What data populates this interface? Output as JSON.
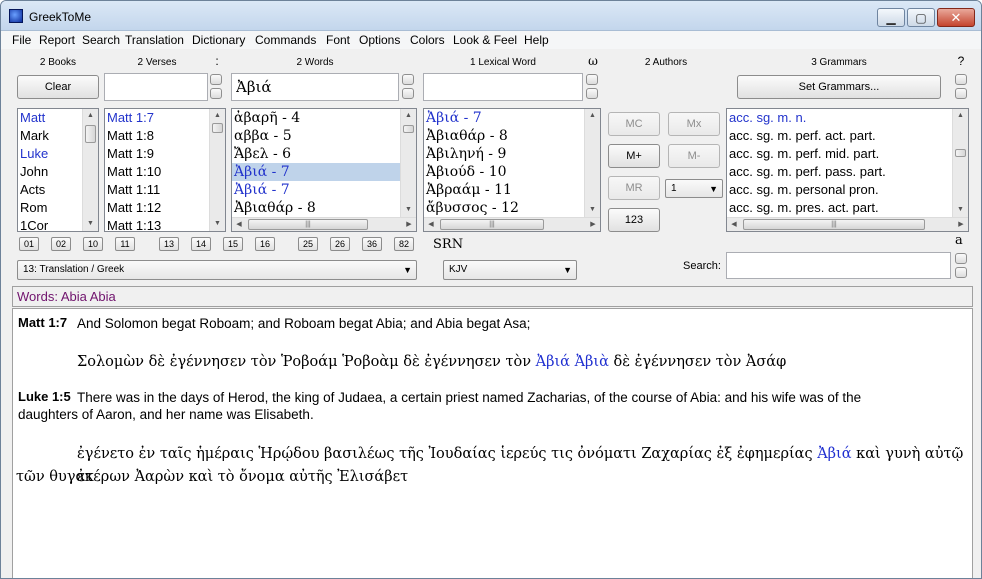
{
  "window": {
    "title": "GreekToMe"
  },
  "menu": [
    "File",
    "Report",
    "Search",
    "Translation",
    "Dictionary",
    "Commands",
    "Font",
    "Options",
    "Colors",
    "Look & Feel",
    "Help"
  ],
  "headers": {
    "books": "2 Books",
    "verses": "2 Verses",
    "words": "2 Words",
    "lexical": "1 Lexical Word",
    "authors": "2 Authors",
    "grammars": "3 Grammars",
    "colon": ":",
    "omega": "ω",
    "question": "?"
  },
  "buttons": {
    "clear": "Clear",
    "set_grammars": "Set Grammars...",
    "mc": "MC",
    "mx": "Mx",
    "mplus": "M+",
    "mminus": "M-",
    "mr": "MR",
    "n123": "123"
  },
  "inputs": {
    "verses_value": "",
    "words_value": "Ἀβιά",
    "lexical_value": "",
    "search_label": "Search:",
    "search_value": ""
  },
  "books": [
    {
      "label": "Matt",
      "blue": true
    },
    {
      "label": "Mark",
      "blue": false
    },
    {
      "label": "Luke",
      "blue": true
    },
    {
      "label": "John",
      "blue": false
    },
    {
      "label": "Acts",
      "blue": false
    },
    {
      "label": "Rom",
      "blue": false
    },
    {
      "label": "1Cor",
      "blue": false
    }
  ],
  "verses": [
    {
      "label": "Matt 1:7",
      "blue": true
    },
    {
      "label": "Matt 1:8",
      "blue": false
    },
    {
      "label": "Matt 1:9",
      "blue": false
    },
    {
      "label": "Matt 1:10",
      "blue": false
    },
    {
      "label": "Matt 1:11",
      "blue": false
    },
    {
      "label": "Matt 1:12",
      "blue": false
    },
    {
      "label": "Matt 1:13",
      "blue": false
    }
  ],
  "words": [
    {
      "label": "ἀβαρῆ - 4",
      "blue": false,
      "sel": false
    },
    {
      "label": "αββα - 5",
      "blue": false,
      "sel": false
    },
    {
      "label": "Ἄβελ - 6",
      "blue": false,
      "sel": false
    },
    {
      "label": "Ἀβιά - 7",
      "blue": true,
      "sel": true
    },
    {
      "label": "Ἀβιά - 7",
      "blue": true,
      "sel": false
    },
    {
      "label": "Ἀβιαθάρ - 8",
      "blue": false,
      "sel": false
    }
  ],
  "lexical_words": [
    {
      "label": "Ἀβιά - 7",
      "blue": true
    },
    {
      "label": "Ἀβιαθάρ - 8",
      "blue": false
    },
    {
      "label": "Ἀβιληνή - 9",
      "blue": false
    },
    {
      "label": "Ἀβιούδ - 10",
      "blue": false
    },
    {
      "label": "Ἀβραάμ - 11",
      "blue": false
    },
    {
      "label": "ἄβυσσος - 12",
      "blue": false
    }
  ],
  "grammars": [
    {
      "label": "acc. sg. m. n.",
      "blue": true
    },
    {
      "label": "acc. sg. m. perf. act. part.",
      "blue": false
    },
    {
      "label": "acc. sg. m. perf. mid. part.",
      "blue": false
    },
    {
      "label": "acc. sg. m. perf. pass. part.",
      "blue": false
    },
    {
      "label": "acc. sg. m. personal pron.",
      "blue": false
    },
    {
      "label": "acc. sg. m. pres. act. part.",
      "blue": false
    }
  ],
  "memory_select": "1",
  "number_buttons": [
    "01",
    "02",
    "10",
    "11",
    "13",
    "14",
    "15",
    "16",
    "25",
    "26",
    "36",
    "82"
  ],
  "srn_label": "SRN",
  "alpha_label": "a",
  "translation_combo": "13:  Translation / Greek",
  "version_combo": "KJV",
  "words_bar": "Words: Abia Abia",
  "passages": [
    {
      "ref": "Matt 1:7",
      "english": "And Solomon begat Roboam; and Roboam begat Abia; and Abia begat Asa;",
      "greek_pre": "Σολομὼν δὲ ἐγέννησεν τὸν Ῥοβοάμ Ῥοβοὰμ δὲ ἐγέννησεν τὸν ",
      "greek_hl": "Ἀβιά Ἀβιὰ",
      "greek_post": " δὲ ἐγέννησεν τὸν Ἀσάφ"
    },
    {
      "ref": "Luke 1:5",
      "english_line1": "There was in the days of Herod, the king of Judaea, a certain priest named Zacharias, of the course of Abia: and his wife was of the",
      "english_line2": "daughters of Aaron, and her name was Elisabeth.",
      "greek_pre": "ἐγένετο ἐν ταῖς ἡμέραις Ἡρῴδου βασιλέως τῆς Ἰουδαίας ἱερεύς τις ὀνόματι Ζαχαρίας ἐξ ἐφημερίας ",
      "greek_hl": "Ἀβιά",
      "greek_post": " καὶ γυνὴ αὐτῷ ἐκ",
      "greek_line2": "τῶν θυγατέρων Ἀαρὼν καὶ τὸ ὄνομα αὐτῆς Ἐλισάβετ"
    }
  ]
}
